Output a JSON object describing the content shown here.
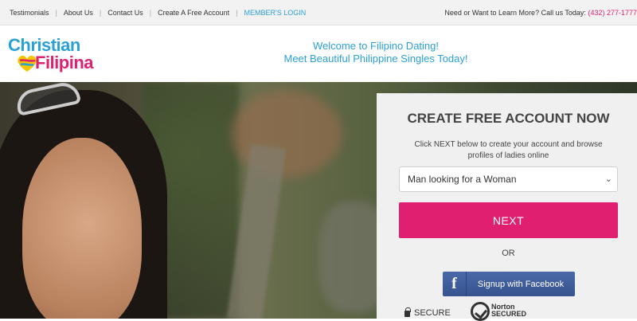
{
  "topbar": {
    "nav": [
      "Testimonials",
      "About Us",
      "Contact Us",
      "Create A Free Account",
      "MEMBER'S LOGIN"
    ],
    "call_text": "Need or Want to Learn More? Call us Today:",
    "phone": "(432) 277-1777"
  },
  "header": {
    "logo_line1": "Christian",
    "logo_line2": "Filipina",
    "welcome_line1": "Welcome to Filipino Dating!",
    "welcome_line2": "Meet Beautiful Philippine Singles Today!"
  },
  "signup": {
    "title": "CREATE FREE ACCOUNT NOW",
    "subtitle": "Click NEXT below to create your account and browse profiles of ladies online",
    "select_value": "Man looking for a Woman",
    "next_label": "NEXT",
    "or_label": "OR",
    "facebook_label": "Signup with Facebook",
    "facebook_icon": "f",
    "secure_label": "SECURE",
    "norton_label": "Norton",
    "norton_sub": "SECURED"
  },
  "colors": {
    "accent_blue": "#2aa0d8",
    "accent_pink": "#e0216f",
    "facebook_blue": "#3b5998"
  },
  "icons": [
    "lock-icon",
    "facebook-icon",
    "norton-check-icon",
    "chevron-down-icon"
  ]
}
